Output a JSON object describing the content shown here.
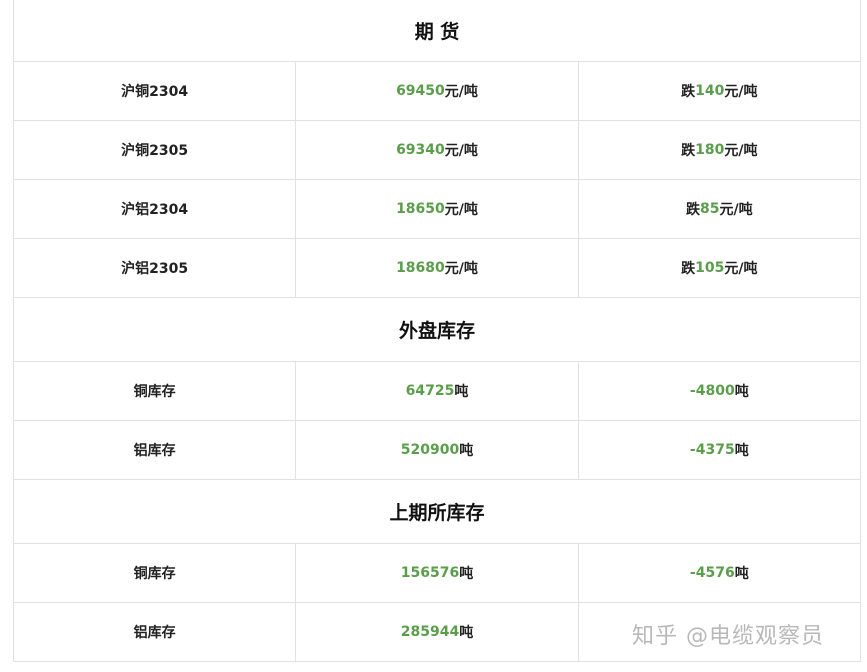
{
  "colors": {
    "accent_green": "#5a9e4b",
    "border": "#e2e2e2"
  },
  "sections": {
    "futures": {
      "title": "期 货",
      "rows": [
        {
          "name": "沪铜2304",
          "price": "69450",
          "price_unit": "元/吨",
          "change_prefix": "跌",
          "change": "140",
          "change_unit": "元/吨"
        },
        {
          "name": "沪铜2305",
          "price": "69340",
          "price_unit": "元/吨",
          "change_prefix": "跌",
          "change": "180",
          "change_unit": "元/吨"
        },
        {
          "name": "沪铝2304",
          "price": "18650",
          "price_unit": "元/吨",
          "change_prefix": "跌",
          "change": "85",
          "change_unit": "元/吨"
        },
        {
          "name": "沪铝2305",
          "price": "18680",
          "price_unit": "元/吨",
          "change_prefix": "跌",
          "change": "105",
          "change_unit": "元/吨"
        }
      ]
    },
    "foreign_inventory": {
      "title": "外盘库存",
      "rows": [
        {
          "name": "铜库存",
          "value": "64725",
          "value_unit": "吨",
          "change": "-4800",
          "change_unit": "吨"
        },
        {
          "name": "铝库存",
          "value": "520900",
          "value_unit": "吨",
          "change": "-4375",
          "change_unit": "吨"
        }
      ]
    },
    "shfe_inventory": {
      "title": "上期所库存",
      "rows": [
        {
          "name": "铜库存",
          "value": "156576",
          "value_unit": "吨",
          "change": "-4576",
          "change_unit": "吨"
        },
        {
          "name": "铝库存",
          "value": "285944",
          "value_unit": "吨",
          "change": "",
          "change_unit": ""
        }
      ]
    }
  },
  "watermark": "知乎 @电缆观察员"
}
